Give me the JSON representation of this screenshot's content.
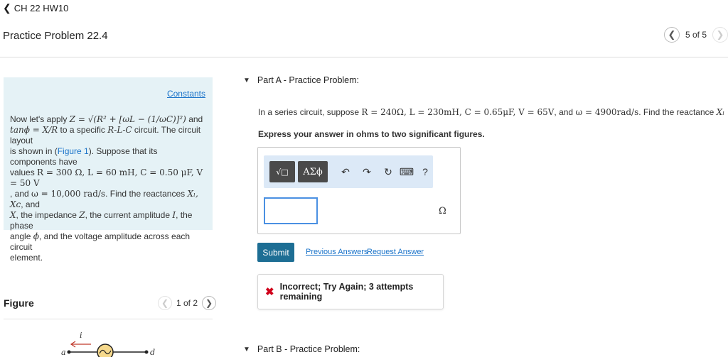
{
  "header": {
    "back_label": "CH 22 HW10",
    "title": "Practice Problem 22.4"
  },
  "pager": {
    "label": "5 of 5"
  },
  "intro": {
    "constants_label": "Constants",
    "line1_pre": "Now let's apply",
    "line1_eq": "Z = √(R² + [ωL − (1/ωC)]²)",
    "line1_post": "and",
    "line2_eq": "tanϕ = X/R",
    "line2_post": "to a specific",
    "line2_circuit": "R-L-C",
    "line2_end": "circuit. The circuit layout",
    "line3_pre": "is shown in (",
    "figure_link": "Figure 1",
    "line3_post": "). Suppose that its components have",
    "line4_pre": "values",
    "line4_vals": "R = 300 Ω, L = 60 mH, C = 0.50 μF, V = 50 V",
    "line5_pre": ", and",
    "line5_omega": "ω = 10,000 rad/s",
    "line5_post": ". Find the reactances",
    "line5_react": "Xₗ, Xᴄ",
    "line5_and": ", and",
    "line6_x": "X",
    "line6_text": ", the impedance",
    "line6_z": "Z",
    "line6_text2": ", the current amplitude",
    "line6_i": "I",
    "line6_text3": ", the phase",
    "line7_pre": "angle",
    "line7_phi": "ϕ",
    "line7_post": ", and the voltage amplitude across each circuit",
    "line8": "element."
  },
  "figure": {
    "label": "Figure",
    "pager_label": "1 of 2",
    "node_a": "a",
    "node_d": "d",
    "current": "i"
  },
  "partA": {
    "title": "Part A - Practice Problem:",
    "problem_pre": "In a series circuit, suppose",
    "problem_vals": "R = 240Ω, L = 230mH, C = 0.65μF, V = 65V",
    "problem_mid": ", and",
    "problem_omega": "ω = 4900rad/s",
    "problem_post": ". Find the reactance",
    "problem_xl": "Xₗ",
    "instruction": "Express your answer in ohms to two significant figures.",
    "answer_value": "",
    "unit": "Ω",
    "toolbar": {
      "templates": "√□",
      "symbols": "ΑΣϕ",
      "undo": "↶",
      "redo": "↷",
      "reset": "↻",
      "keyboard": "⌨",
      "help": "?"
    },
    "submit_label": "Submit",
    "previous_answers": "Previous Answers",
    "request_answer": "Request Answer",
    "feedback": "Incorrect; Try Again; 3 attempts remaining"
  },
  "partB": {
    "title": "Part B - Practice Problem:"
  }
}
